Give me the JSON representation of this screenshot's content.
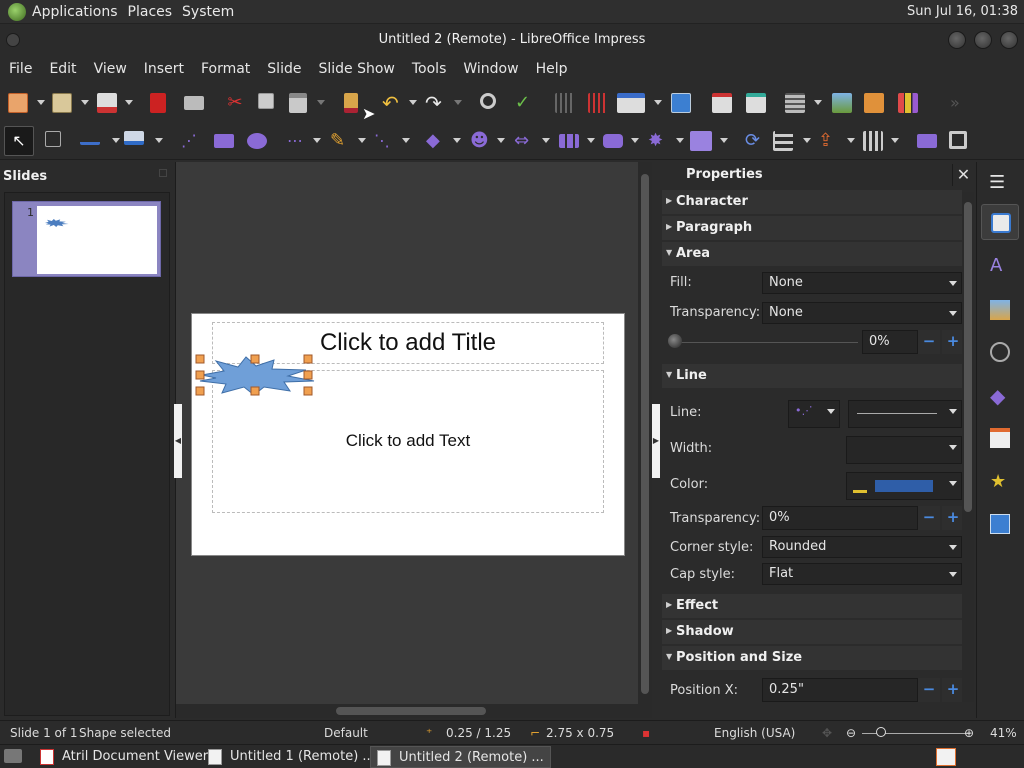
{
  "top_panel": {
    "menus": [
      "Applications",
      "Places",
      "System"
    ],
    "clock": "Sun Jul 16, 01:38"
  },
  "window": {
    "title": "Untitled 2 (Remote) - LibreOffice Impress"
  },
  "menubar": [
    "File",
    "Edit",
    "View",
    "Insert",
    "Format",
    "Slide",
    "Slide Show",
    "Tools",
    "Window",
    "Help"
  ],
  "slides_pane": {
    "title": "Slides",
    "slide_number": "1"
  },
  "slide": {
    "title_placeholder": "Click to add Title",
    "body_placeholder": "Click to add Text",
    "shape_color": "#6f9fd8"
  },
  "properties": {
    "title": "Properties",
    "close": "✕",
    "sections": {
      "character": "Character",
      "paragraph": "Paragraph",
      "area": "Area",
      "line": "Line",
      "effect": "Effect",
      "shadow": "Shadow",
      "position_size": "Position and Size"
    },
    "area": {
      "fill_label": "Fill:",
      "fill_value": "None",
      "transparency_label": "Transparency:",
      "transparency_value": "None",
      "transparency_percent": "0%"
    },
    "line": {
      "line_label": "Line:",
      "width_label": "Width:",
      "color_label": "Color:",
      "color_value": "#2f5ea8",
      "transparency_label": "Transparency:",
      "transparency_value": "0%",
      "corner_label": "Corner style:",
      "corner_value": "Rounded",
      "cap_label": "Cap style:",
      "cap_value": "Flat"
    },
    "position": {
      "x_label": "Position X:",
      "x_value": "0.25\""
    }
  },
  "statusbar": {
    "slide": "Slide 1 of 1",
    "selection": "Shape selected",
    "master": "Default",
    "position": "0.25 / 1.25",
    "size": "2.75 x 0.75",
    "language": "English (USA)",
    "zoom": "41%"
  },
  "taskbar": {
    "tasks": [
      "Atril Document Viewer",
      "Untitled 1 (Remote) ...",
      "Untitled 2 (Remote) ..."
    ]
  }
}
